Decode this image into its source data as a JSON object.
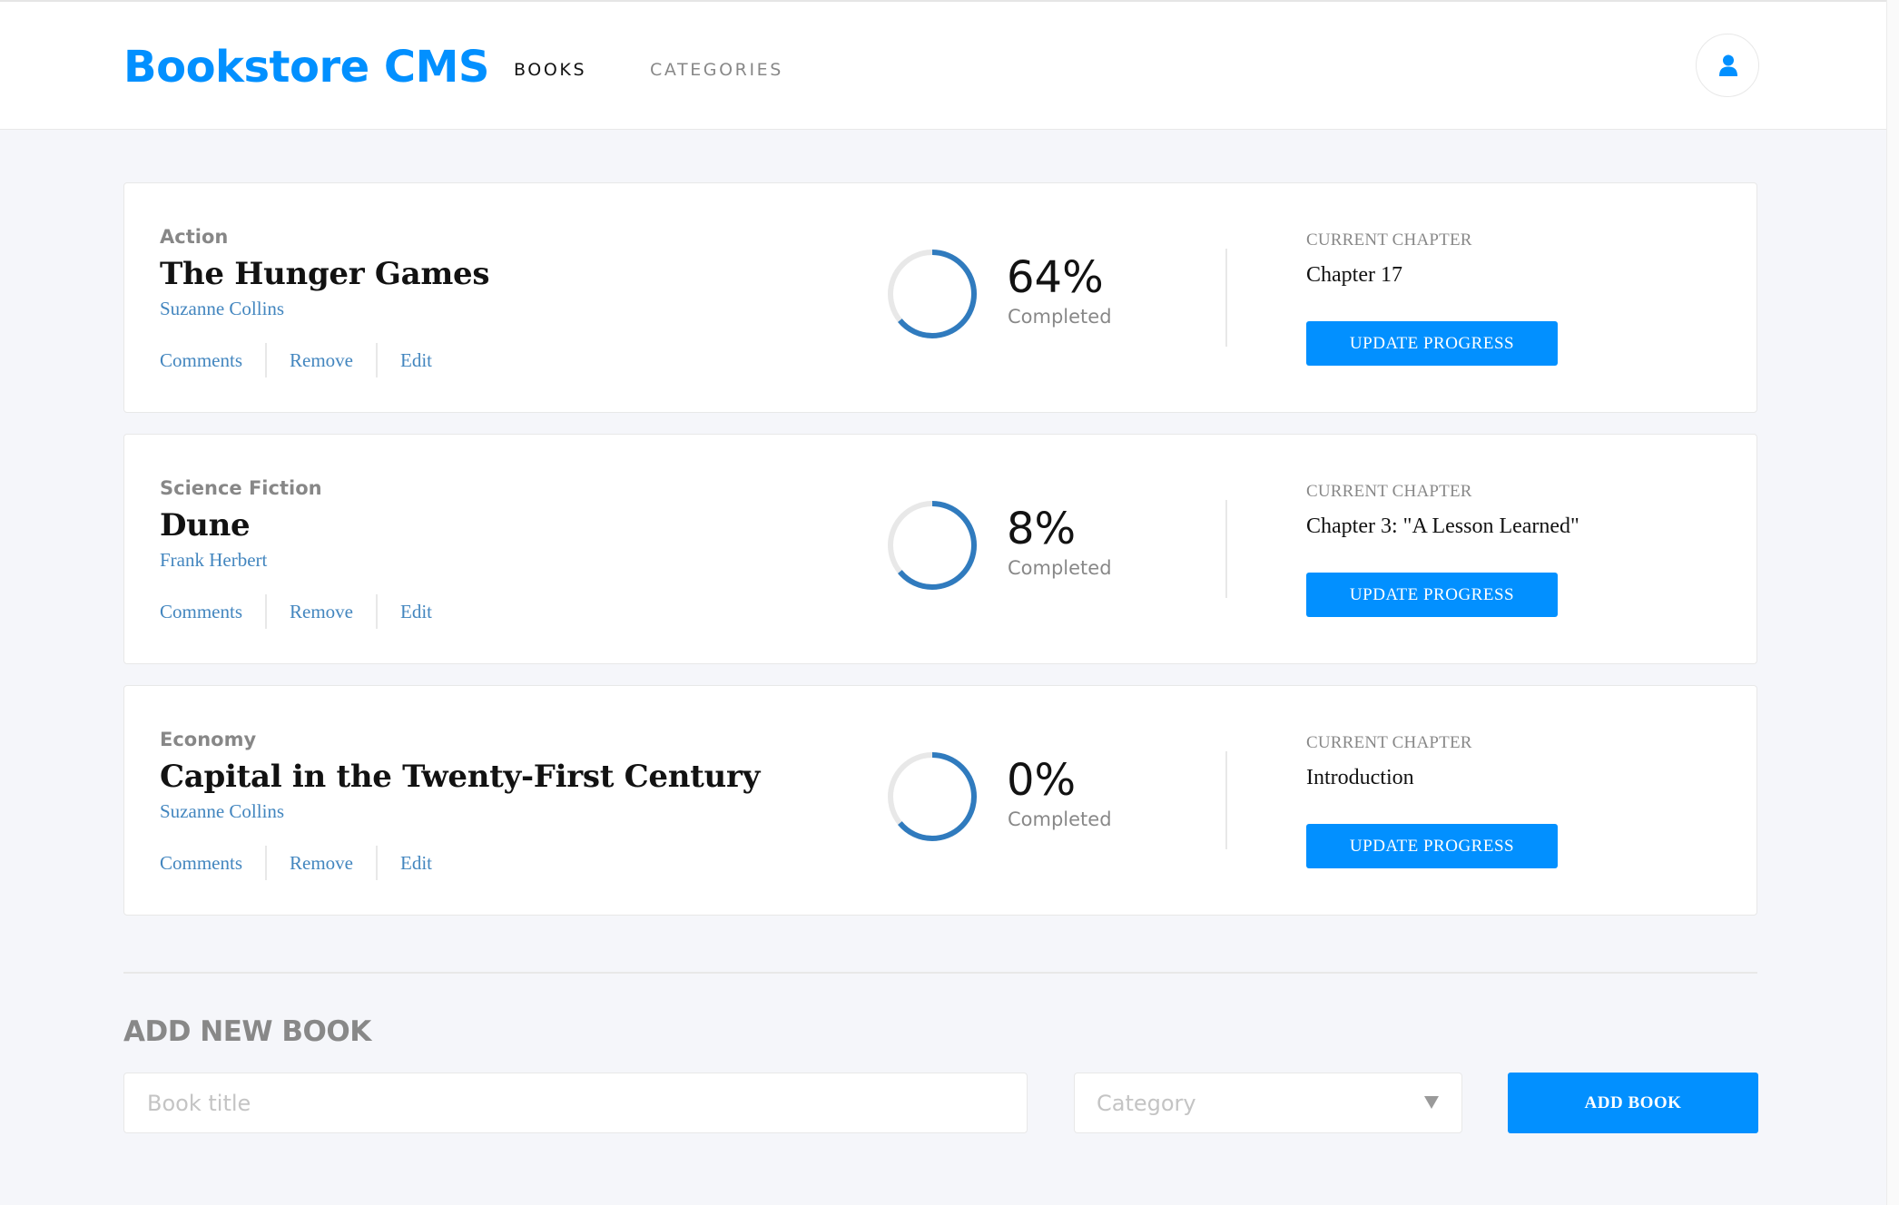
{
  "header": {
    "logo": "Bookstore CMS",
    "nav": [
      {
        "label": "BOOKS"
      },
      {
        "label": "CATEGORIES"
      }
    ],
    "user_icon": "user-icon"
  },
  "books": [
    {
      "genre": "Action",
      "title": "The Hunger Games",
      "author": "Suzanne Collins",
      "actions": [
        "Comments",
        "Remove",
        "Edit"
      ],
      "progress_percent": 64,
      "percent_label": "64%",
      "completed_label": "Completed",
      "chapter_label": "CURRENT CHAPTER",
      "chapter": "Chapter 17",
      "update_label": "UPDATE PROGRESS"
    },
    {
      "genre": "Science Fiction",
      "title": "Dune",
      "author": "Frank Herbert",
      "actions": [
        "Comments",
        "Remove",
        "Edit"
      ],
      "progress_percent": 8,
      "percent_label": "8%",
      "completed_label": "Completed",
      "chapter_label": "CURRENT CHAPTER",
      "chapter": "Chapter 3: \"A Lesson Learned\"",
      "update_label": "UPDATE PROGRESS"
    },
    {
      "genre": "Economy",
      "title": "Capital in the Twenty-First Century",
      "author": "Suzanne Collins",
      "actions": [
        "Comments",
        "Remove",
        "Edit"
      ],
      "progress_percent": 0,
      "percent_label": "0%",
      "completed_label": "Completed",
      "chapter_label": "CURRENT CHAPTER",
      "chapter": "Introduction",
      "update_label": "UPDATE PROGRESS"
    }
  ],
  "form": {
    "title": "ADD NEW BOOK",
    "title_placeholder": "Book title",
    "category_placeholder": "Category",
    "submit_label": "ADD BOOK"
  },
  "colors": {
    "accent": "#0290ff",
    "link": "#4386bf",
    "ring": "#307bbe"
  }
}
